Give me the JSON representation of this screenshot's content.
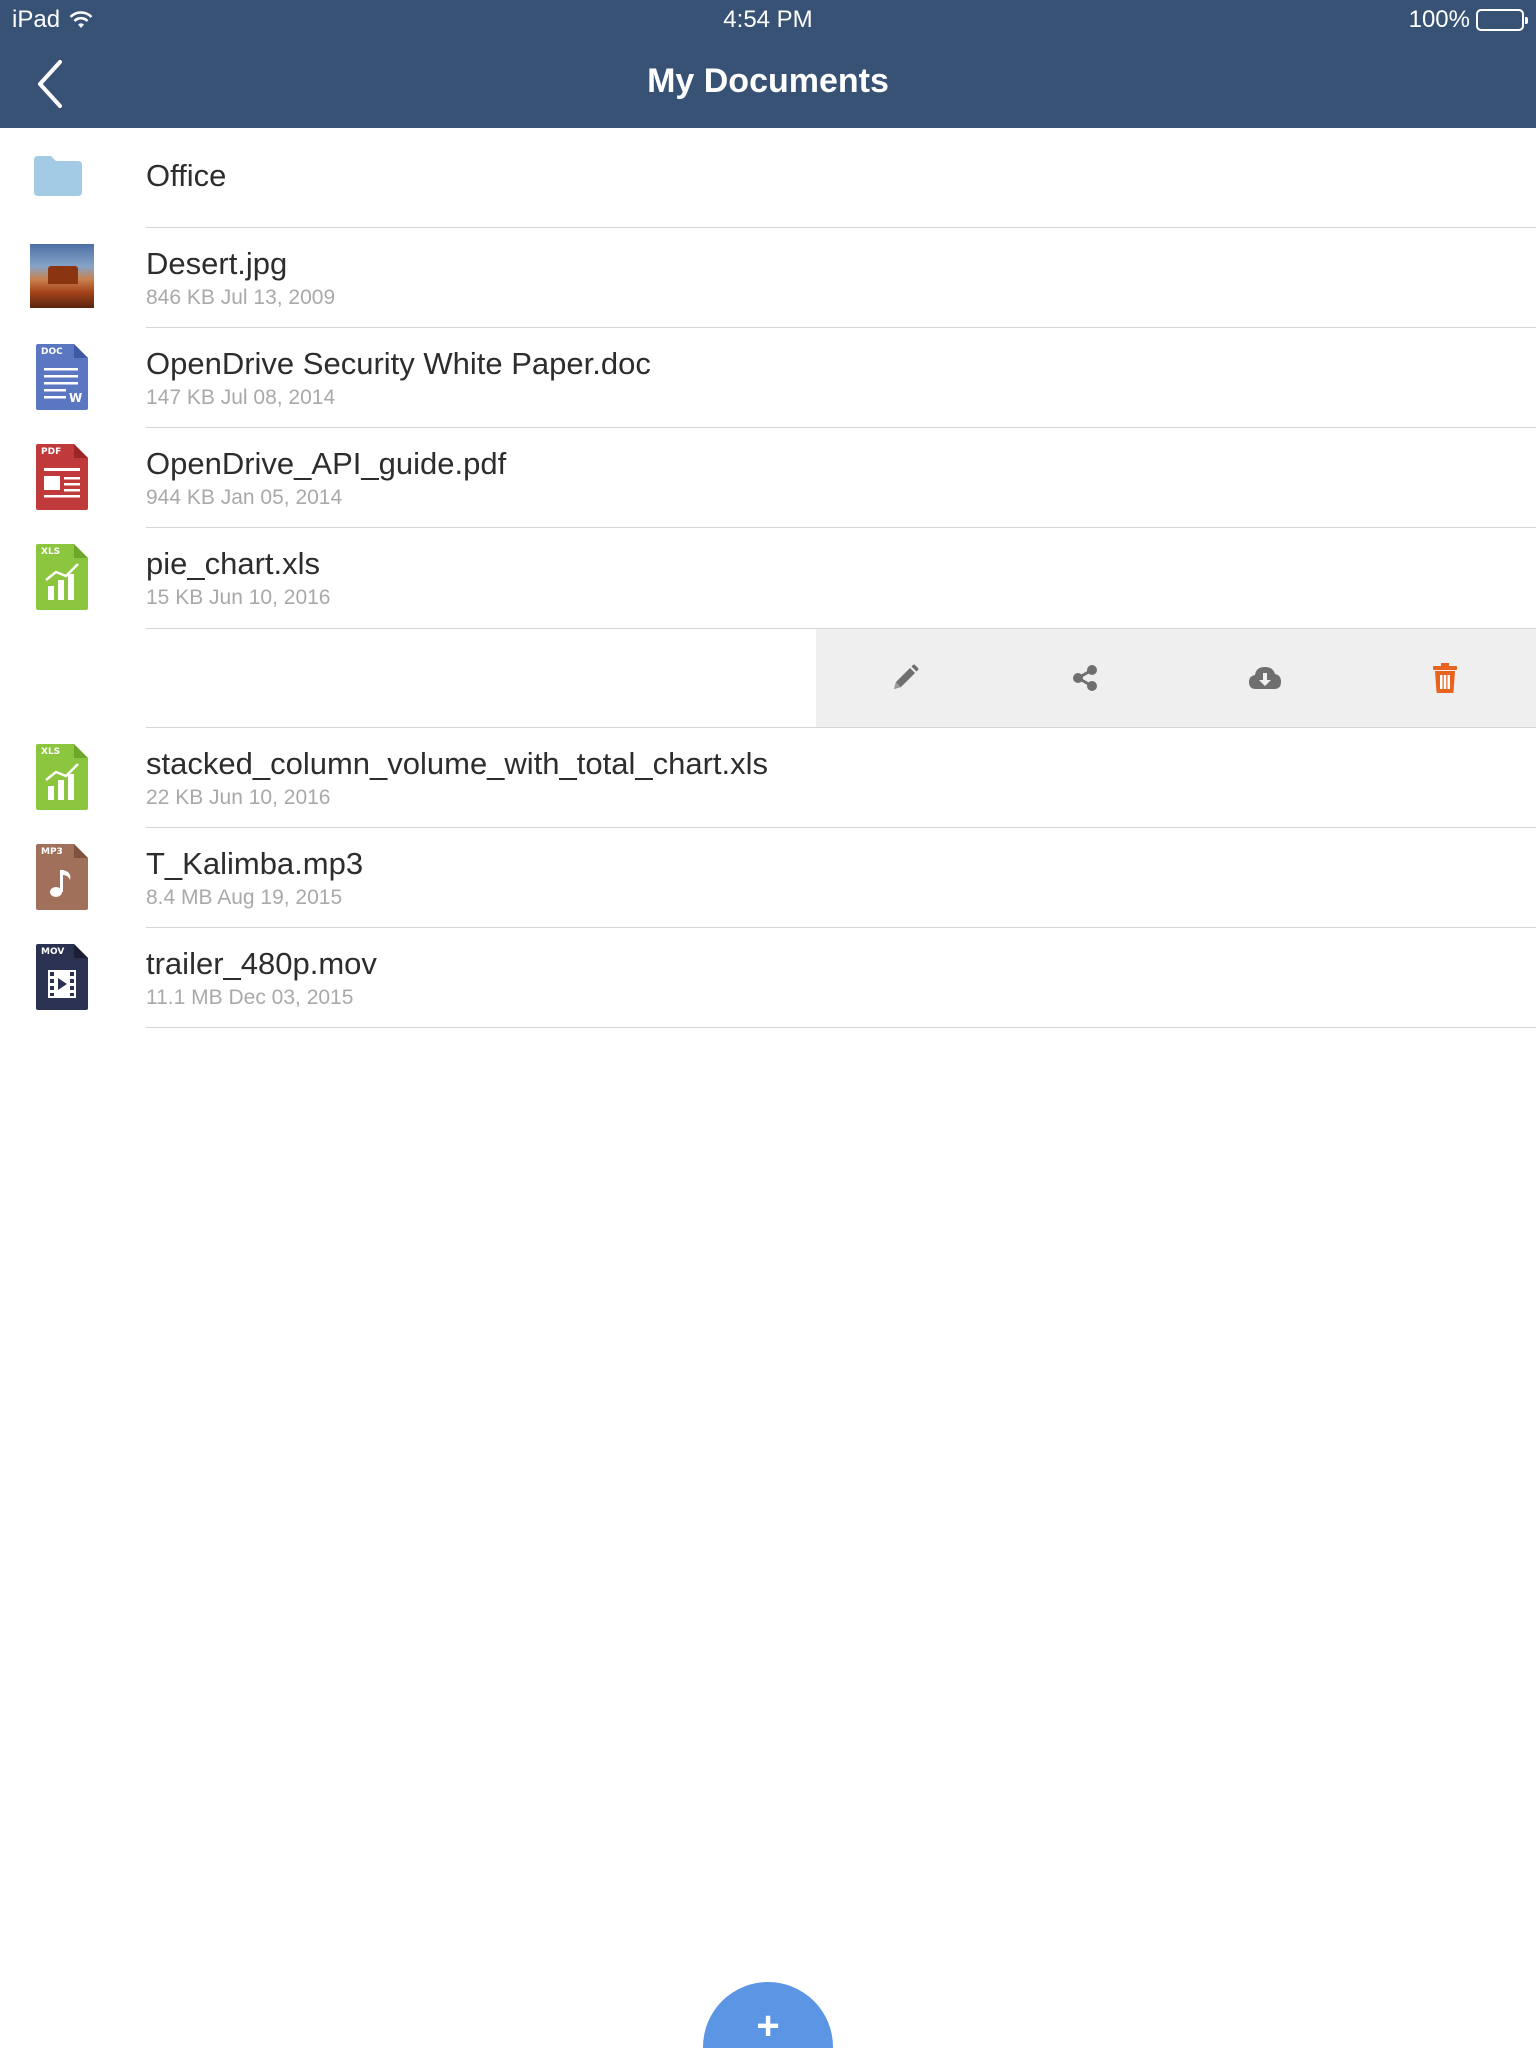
{
  "status_bar": {
    "device": "iPad",
    "time": "4:54 PM",
    "battery": "100%"
  },
  "nav": {
    "title": "My Documents"
  },
  "items": [
    {
      "name": "Office",
      "kind": "folder"
    },
    {
      "name": "Desert.jpg",
      "meta": "846 KB Jul 13, 2009",
      "kind": "image"
    },
    {
      "name": "OpenDrive Security White Paper.doc",
      "meta": "147 KB Jul 08, 2014",
      "kind": "doc",
      "tag": "DOC"
    },
    {
      "name": "OpenDrive_API_guide.pdf",
      "meta": "944 KB Jan 05, 2014",
      "kind": "pdf",
      "tag": "PDF"
    },
    {
      "name": "pie_chart.xls",
      "meta": "15 KB Jun 10, 2016",
      "kind": "xls",
      "tag": "XLS"
    },
    {
      "name": "stacked_column_volume_with_total_chart.xls",
      "meta": "22 KB Jun 10, 2016",
      "kind": "xls",
      "tag": "XLS"
    },
    {
      "name": "T_Kalimba.mp3",
      "meta": "8.4 MB Aug 19, 2015",
      "kind": "mp3",
      "tag": "MP3"
    },
    {
      "name": "trailer_480p.mov",
      "meta": "11.1 MB Dec 03, 2015",
      "kind": "mov",
      "tag": "MOV"
    }
  ],
  "actions": [
    "pencil-icon",
    "share-icon",
    "cloud-download-icon",
    "trash-icon"
  ],
  "colors": {
    "header": "#375274",
    "fab": "#5b95e4",
    "delete": "#e8641e",
    "doc": "#5b77c2",
    "pdf": "#c0393b",
    "xls": "#8cc63f",
    "mp3": "#a0705a",
    "mov": "#2b3150",
    "folder": "#a3cbe6"
  },
  "fab": {
    "icon": "plus-icon",
    "label": "+"
  }
}
